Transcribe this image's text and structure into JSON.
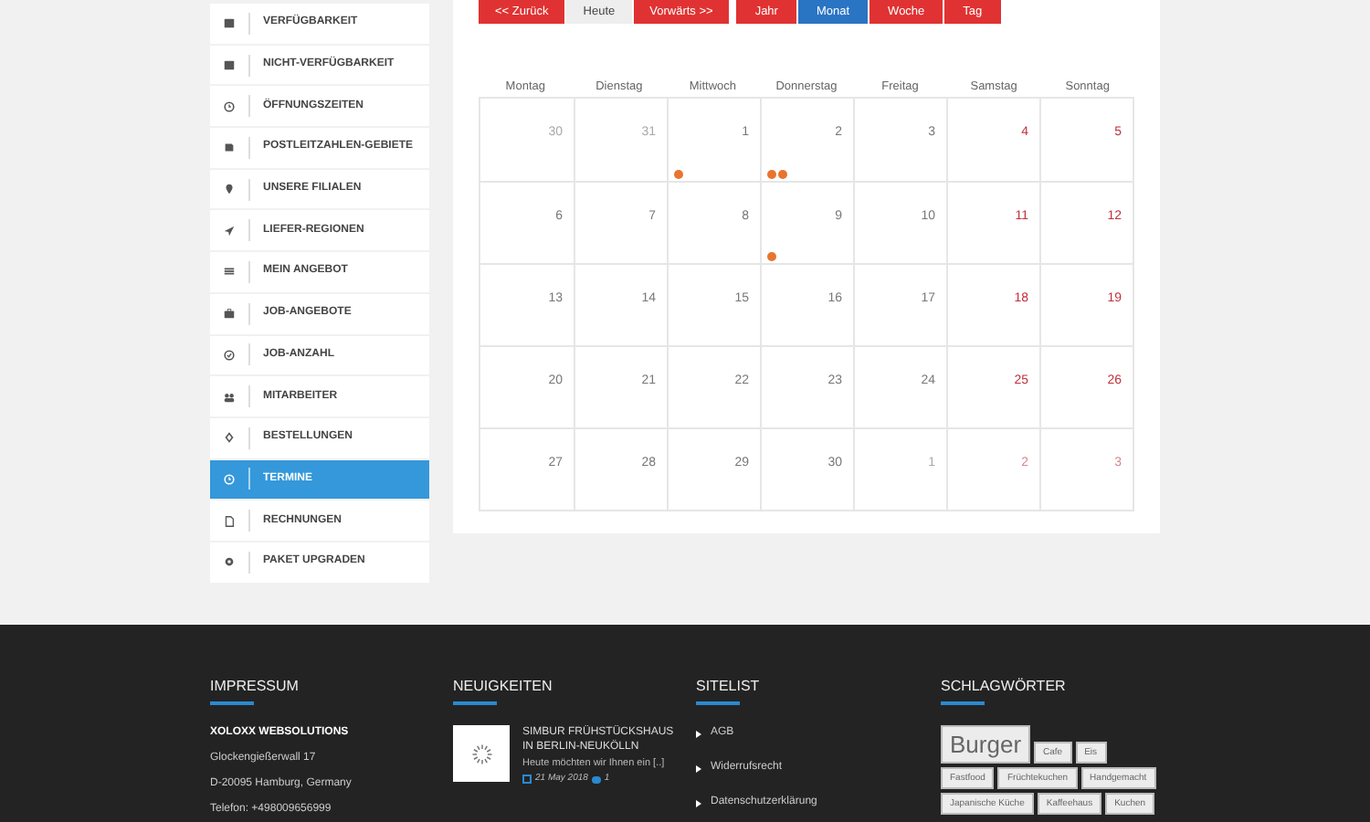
{
  "sidebar": {
    "items": [
      {
        "label": "VERFÜGBARKEIT",
        "selected": false
      },
      {
        "label": "NICHT-VERFÜGBARKEIT",
        "selected": false
      },
      {
        "label": "ÖFFNUNGSZEITEN",
        "selected": false
      },
      {
        "label": "POSTLEITZAHLEN-GEBIETE",
        "selected": false
      },
      {
        "label": "UNSERE FILIALEN",
        "selected": false
      },
      {
        "label": "LIEFER-REGIONEN",
        "selected": false
      },
      {
        "label": "MEIN ANGEBOT",
        "selected": false
      },
      {
        "label": "JOB-ANGEBOTE",
        "selected": false
      },
      {
        "label": "JOB-ANZAHL",
        "selected": false
      },
      {
        "label": "MITARBEITER",
        "selected": false
      },
      {
        "label": "BESTELLUNGEN",
        "selected": false
      },
      {
        "label": "TERMINE",
        "selected": true
      },
      {
        "label": "RECHNUNGEN",
        "selected": false
      },
      {
        "label": "PAKET UPGRADEN",
        "selected": false
      }
    ]
  },
  "calendar": {
    "nav_buttons": [
      {
        "label": "<< Zurück",
        "disabled": false
      },
      {
        "label": "Heute",
        "disabled": true
      },
      {
        "label": "Vorwärts >>",
        "disabled": false
      }
    ],
    "view_buttons": [
      {
        "label": "Jahr",
        "selected": false
      },
      {
        "label": "Monat",
        "selected": true
      },
      {
        "label": "Woche",
        "selected": false
      },
      {
        "label": "Tag",
        "selected": false
      }
    ],
    "weekdays": [
      "Montag",
      "Dienstag",
      "Mittwoch",
      "Donnerstag",
      "Freitag",
      "Samstag",
      "Sonntag"
    ],
    "weeks": [
      [
        {
          "day": "30",
          "other_month": true,
          "weekend": false
        },
        {
          "day": "31",
          "other_month": true,
          "weekend": false
        },
        {
          "day": "1",
          "other_month": false,
          "weekend": false,
          "events": [
            {
              "color": "#e8742f"
            }
          ]
        },
        {
          "day": "2",
          "other_month": false,
          "weekend": false,
          "events": [
            {
              "color": "#e8742f"
            },
            {
              "color": "#e8742f"
            }
          ]
        },
        {
          "day": "3",
          "other_month": false,
          "weekend": false
        },
        {
          "day": "4",
          "other_month": false,
          "weekend": true
        },
        {
          "day": "5",
          "other_month": false,
          "weekend": true
        }
      ],
      [
        {
          "day": "6",
          "other_month": false,
          "weekend": false
        },
        {
          "day": "7",
          "other_month": false,
          "weekend": false
        },
        {
          "day": "8",
          "other_month": false,
          "weekend": false
        },
        {
          "day": "9",
          "other_month": false,
          "weekend": false,
          "events": [
            {
              "color": "#e8742f"
            }
          ]
        },
        {
          "day": "10",
          "other_month": false,
          "weekend": false
        },
        {
          "day": "11",
          "other_month": false,
          "weekend": true
        },
        {
          "day": "12",
          "other_month": false,
          "weekend": true
        }
      ],
      [
        {
          "day": "13",
          "other_month": false,
          "weekend": false
        },
        {
          "day": "14",
          "other_month": false,
          "weekend": false
        },
        {
          "day": "15",
          "other_month": false,
          "weekend": false
        },
        {
          "day": "16",
          "other_month": false,
          "weekend": false
        },
        {
          "day": "17",
          "other_month": false,
          "weekend": false
        },
        {
          "day": "18",
          "other_month": false,
          "weekend": true
        },
        {
          "day": "19",
          "other_month": false,
          "weekend": true
        }
      ],
      [
        {
          "day": "20",
          "other_month": false,
          "weekend": false
        },
        {
          "day": "21",
          "other_month": false,
          "weekend": false
        },
        {
          "day": "22",
          "other_month": false,
          "weekend": false
        },
        {
          "day": "23",
          "other_month": false,
          "weekend": false
        },
        {
          "day": "24",
          "other_month": false,
          "weekend": false
        },
        {
          "day": "25",
          "other_month": false,
          "weekend": true
        },
        {
          "day": "26",
          "other_month": false,
          "weekend": true
        }
      ],
      [
        {
          "day": "27",
          "other_month": false,
          "weekend": false
        },
        {
          "day": "28",
          "other_month": false,
          "weekend": false
        },
        {
          "day": "29",
          "other_month": false,
          "weekend": false
        },
        {
          "day": "30",
          "other_month": false,
          "weekend": false
        },
        {
          "day": "1",
          "other_month": true,
          "weekend": false
        },
        {
          "day": "2",
          "other_month": true,
          "weekend": true
        },
        {
          "day": "3",
          "other_month": true,
          "weekend": true
        }
      ]
    ]
  },
  "footer": {
    "impressum": {
      "title": "IMPRESSUM",
      "company": "XOLOXX WEBSOLUTIONS",
      "lines": [
        "Glockengießerwall 17",
        "D-20095 Hamburg, Germany",
        "Telefon: +498009656999"
      ]
    },
    "news": {
      "title": "NEUIGKEITEN",
      "items": [
        {
          "title": "SIMBUR FRÜHSTÜCKSHAUS IN BERLIN-NEUKÖLLN",
          "excerpt": "Heute möchten wir Ihnen ein [..]",
          "date": "21 May 2018",
          "comments": "1"
        }
      ]
    },
    "sitelist": {
      "title": "SITELIST",
      "links": [
        "AGB",
        "Widerrufsrecht",
        "Datenschutzerklärung"
      ]
    },
    "tags": {
      "title": "SCHLAGWÖRTER",
      "items": [
        {
          "label": "Burger",
          "kind": "large"
        },
        {
          "label": "Cafe",
          "kind": "small"
        },
        {
          "label": "Eis",
          "kind": "small"
        },
        {
          "label": "Fastfood",
          "kind": "small"
        },
        {
          "label": "Früchtekuchen",
          "kind": "small"
        },
        {
          "label": "Handgemacht",
          "kind": "small"
        },
        {
          "label": "Japanische Küche",
          "kind": "small"
        },
        {
          "label": "Kaffeehaus",
          "kind": "small"
        },
        {
          "label": "Kuchen",
          "kind": "small"
        }
      ]
    }
  }
}
